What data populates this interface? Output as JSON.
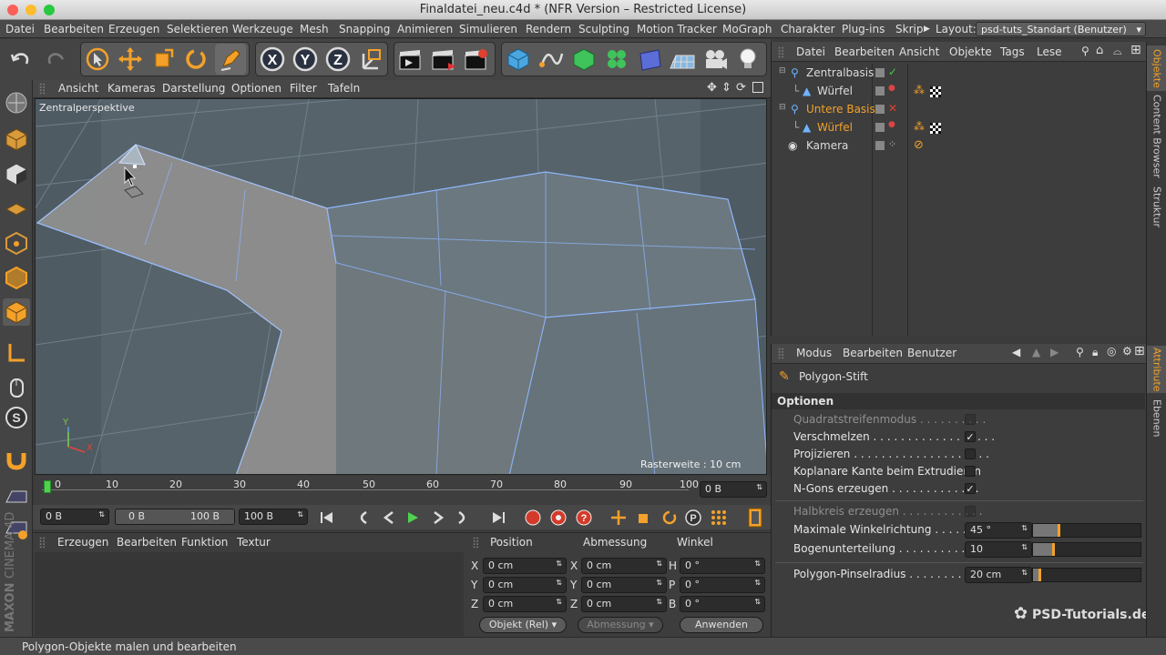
{
  "window": {
    "title": "Finaldatei_neu.c4d * (NFR Version – Restricted License)"
  },
  "menu": {
    "items": [
      "Datei",
      "Bearbeiten",
      "Erzeugen",
      "Selektieren",
      "Werkzeuge",
      "Mesh",
      "Snapping",
      "Animieren",
      "Simulieren",
      "Rendern",
      "Sculpting",
      "Motion Tracker",
      "MoGraph",
      "Charakter",
      "Plug-ins",
      "Skrip"
    ],
    "layout_label": "Layout:",
    "layout_value": "psd-tuts_Standart (Benutzer)"
  },
  "toolbar": {
    "axis_x": "X",
    "axis_y": "Y",
    "axis_z": "Z"
  },
  "viewport": {
    "menu": [
      "Ansicht",
      "Kameras",
      "Darstellung",
      "Optionen",
      "Filter",
      "Tafeln"
    ],
    "camera_label": "Zentralperspektive",
    "grid_info": "Rasterweite : 10 cm",
    "axis_y": "Y",
    "axis_x": "X"
  },
  "timeline": {
    "ticks": [
      "0",
      "10",
      "20",
      "30",
      "40",
      "50",
      "60",
      "70",
      "80",
      "90",
      "100"
    ],
    "current_frame_field": "0 B",
    "start_field": "0 B",
    "range_start": "0 B",
    "range_end": "100 B",
    "end_field": "100 B"
  },
  "materials": {
    "menu": [
      "Erzeugen",
      "Bearbeiten",
      "Funktion",
      "Textur"
    ]
  },
  "coordinates": {
    "headers": [
      "Position",
      "Abmessung",
      "Winkel"
    ],
    "rows": [
      {
        "axis": "X",
        "pos": "0 cm",
        "size_axis": "X",
        "size": "0 cm",
        "rot_axis": "H",
        "rot": "0 °"
      },
      {
        "axis": "Y",
        "pos": "0 cm",
        "size_axis": "Y",
        "size": "0 cm",
        "rot_axis": "P",
        "rot": "0 °"
      },
      {
        "axis": "Z",
        "pos": "0 cm",
        "size_axis": "Z",
        "size": "0 cm",
        "rot_axis": "B",
        "rot": "0 °"
      }
    ],
    "mode_dropdown": "Objekt (Rel)",
    "size_dropdown": "Abmessung",
    "apply_button": "Anwenden"
  },
  "objects": {
    "menu": [
      "Datei",
      "Bearbeiten",
      "Ansicht",
      "Objekte",
      "Tags",
      "Lese"
    ],
    "items": [
      {
        "name": "Zentralbasis",
        "status": "✓"
      },
      {
        "name": "Würfel",
        "status": ""
      },
      {
        "name": "Untere Basis",
        "status": "✕"
      },
      {
        "name": "Würfel",
        "status": ""
      },
      {
        "name": "Kamera",
        "status": ""
      }
    ]
  },
  "attributes": {
    "menu": [
      "Modus",
      "Bearbeiten",
      "Benutzer"
    ],
    "tool_name": "Polygon-Stift",
    "section": "Optionen",
    "options": [
      {
        "label": "Quadratstreifenmodus . . . . . . . . . .",
        "checked": false,
        "enabled": false
      },
      {
        "label": "Verschmelzen . . . . . . . . . . . . . . . . . .",
        "checked": true,
        "enabled": true
      },
      {
        "label": "Projizieren . . . . . . . . . . . . . . . . . . . .",
        "checked": false,
        "enabled": true
      },
      {
        "label": "Koplanare Kante beim Extrudieren",
        "checked": false,
        "enabled": true
      },
      {
        "label": "N-Gons erzeugen . . . . . . . . . . . . .",
        "checked": true,
        "enabled": true
      },
      {
        "label": "Halbkreis erzeugen . . . . . . . . . . . .",
        "checked": false,
        "enabled": false
      }
    ],
    "sliders": [
      {
        "label": "Maximale Winkelrichtung . . . . . . .",
        "value": "45 °",
        "fill": 0.25
      },
      {
        "label": "Bogenunterteilung . . . . . . . . . . . .",
        "value": "10",
        "fill": 0.2
      },
      {
        "label": "Polygon-Pinselradius . . . . . . . . . .",
        "value": "20 cm",
        "fill": 0.08
      }
    ]
  },
  "sidebar_tabs": {
    "objects": "Objekte",
    "content": "Content Browser",
    "structure": "Struktur",
    "attributes": "Attribute",
    "layers": "Ebenen"
  },
  "branding": {
    "maxon": "MAXON",
    "cinema": "CINEMA 4D",
    "psd": "PSD-Tutorials.de"
  },
  "status": {
    "text": "Polygon-Objekte malen und bearbeiten"
  },
  "colors": {
    "accent": "#f3a12a",
    "axis_y": "#78c840",
    "axis_x": "#e04030",
    "selection": "#f5a623"
  }
}
